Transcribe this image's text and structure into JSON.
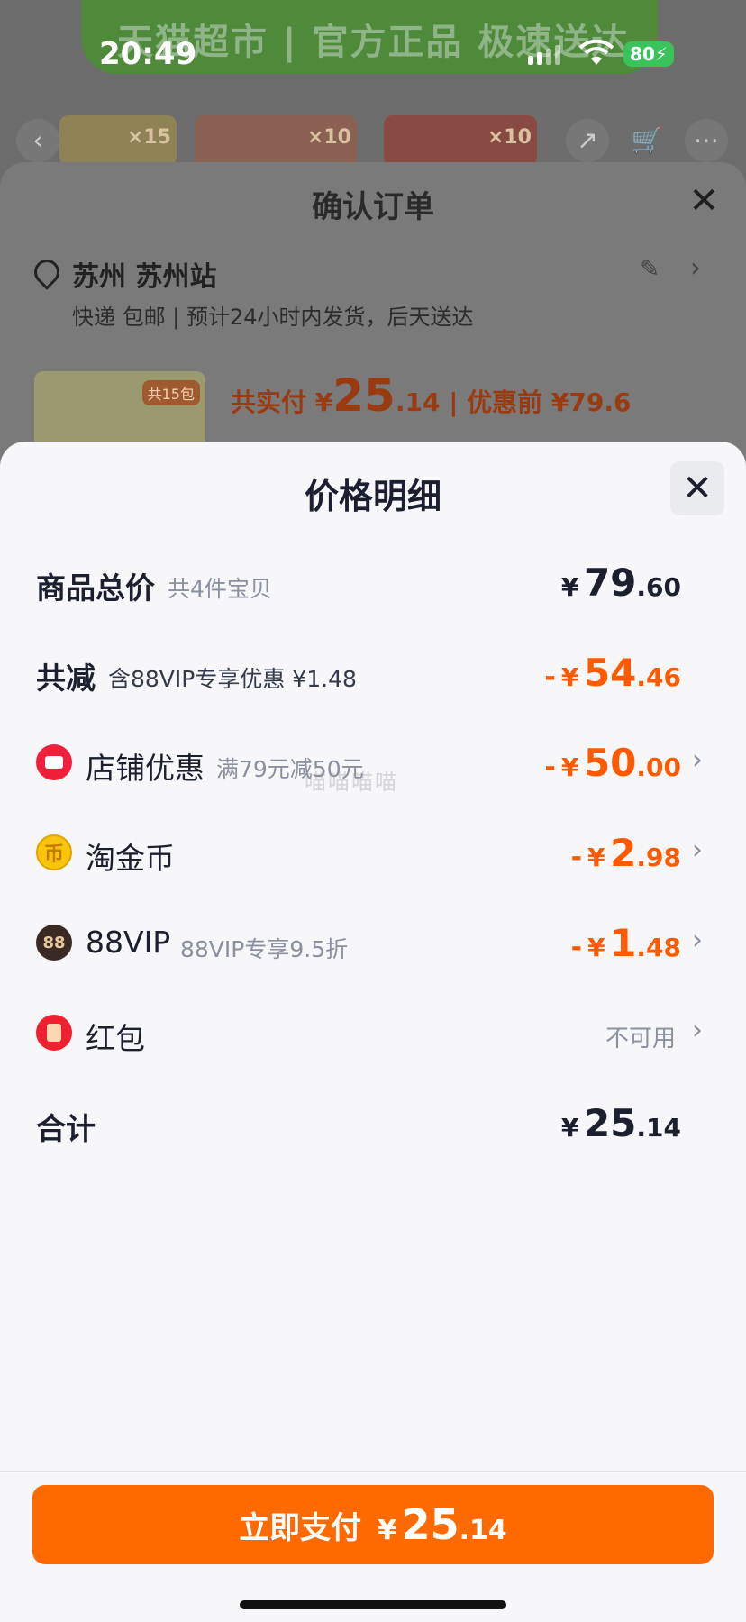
{
  "status_bar": {
    "time": "20:49",
    "battery": "80"
  },
  "background": {
    "banner_text": "天猫超市 | 官方正品 极速送达",
    "thumb_badges": [
      "×15",
      "×10",
      "×10"
    ],
    "order_title": "确认订单",
    "address_name": "苏州 苏州站",
    "address_sub": "快递 包邮 | 预计24小时内发货，后天送达",
    "pay_prefix": "共实付 ¥",
    "pay_int": "25",
    "pay_dec": ".14",
    "pay_suffix": "| 优惠前 ¥79.6",
    "thumb_badge_product": "共15包"
  },
  "panel": {
    "title": "价格明细",
    "rows": [
      {
        "label": "商品总价",
        "sub": "共4件宝贝",
        "yen": "¥",
        "int": "79",
        "dec": ".60",
        "minus": ""
      },
      {
        "label": "共减",
        "sub": "含88VIP专享优惠 ¥1.48",
        "yen": "¥",
        "int": "54",
        "dec": ".46",
        "minus": "-"
      },
      {
        "label": "店铺优惠",
        "sub": "满79元减50元",
        "yen": "¥",
        "int": "50",
        "dec": ".00",
        "minus": "-"
      },
      {
        "label": "淘金币",
        "sub": "",
        "yen": "¥",
        "int": "2",
        "dec": ".98",
        "minus": "-"
      },
      {
        "label": "88VIP",
        "sub": "88VIP专享9.5折",
        "yen": "¥",
        "int": "1",
        "dec": ".48",
        "minus": "-"
      },
      {
        "label": "红包",
        "value_text": "不可用"
      },
      {
        "label": "合计",
        "yen": "¥",
        "int": "25",
        "dec": ".14"
      }
    ],
    "icons": {
      "coin_glyph": "币",
      "vip_glyph": "88"
    }
  },
  "watermark": "喵喵喵喵",
  "pay_button": {
    "label": "立即支付",
    "yen": "¥",
    "int": "25",
    "dec": ".14"
  },
  "colors": {
    "accent": "#ff6a00",
    "discount": "#ff5a00",
    "text": "#1b1f2e",
    "muted": "#8a90a0"
  }
}
